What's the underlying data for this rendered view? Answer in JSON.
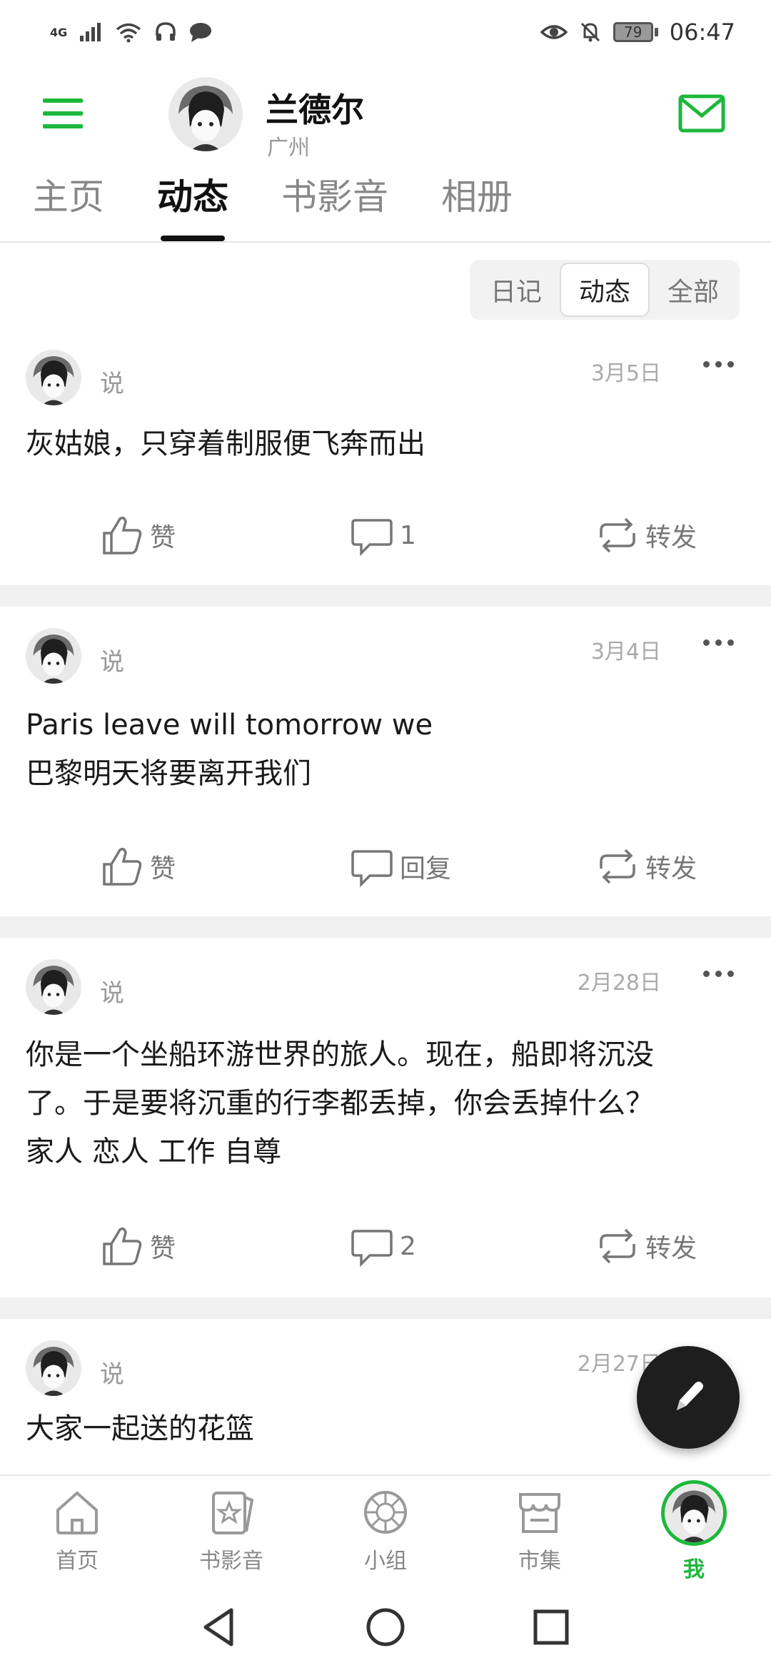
{
  "status_bar": {
    "network": "4G",
    "battery": "79",
    "time": "06:47"
  },
  "header": {
    "name": "兰德尔",
    "location": "广州"
  },
  "tabs": [
    {
      "label": "主页"
    },
    {
      "label": "动态"
    },
    {
      "label": "书影音"
    },
    {
      "label": "相册"
    }
  ],
  "active_tab": "动态",
  "filter": {
    "options": [
      "日记",
      "动态",
      "全部"
    ],
    "selected": "动态"
  },
  "posts": [
    {
      "type_label": "说",
      "date": "3月5日",
      "text_lines": [
        "灰姑娘，只穿着制服便飞奔而出"
      ],
      "like_label": "赞",
      "comment_label": "1",
      "share_label": "转发"
    },
    {
      "type_label": "说",
      "date": "3月4日",
      "text_lines": [
        "Paris leave will tomorrow we",
        "巴黎明天将要离开我们"
      ],
      "like_label": "赞",
      "comment_label": "回复",
      "share_label": "转发"
    },
    {
      "type_label": "说",
      "date": "2月28日",
      "text_lines": [
        "你是一个坐船环游世界的旅人。现在，船即将沉没",
        "了。于是要将沉重的行李都丢掉，你会丢掉什么？",
        "家人 恋人 工作 自尊"
      ],
      "like_label": "赞",
      "comment_label": "2",
      "share_label": "转发"
    },
    {
      "type_label": "说",
      "date": "2月27日",
      "text_lines": [
        "大家一起送的花篮"
      ]
    }
  ],
  "bottom_nav": [
    {
      "label": "首页",
      "icon": "home-icon"
    },
    {
      "label": "书影音",
      "icon": "book-star-icon"
    },
    {
      "label": "小组",
      "icon": "group-icon"
    },
    {
      "label": "市集",
      "icon": "store-icon"
    },
    {
      "label": "我",
      "icon": "avatar"
    }
  ],
  "colors": {
    "accent": "#1db83b",
    "fab": "#1e1e1e",
    "divider": "#f0f0f0"
  }
}
